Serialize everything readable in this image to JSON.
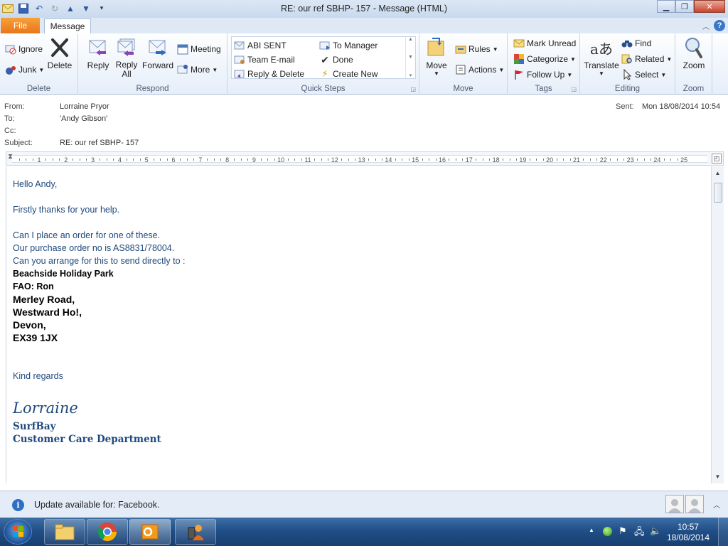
{
  "window": {
    "title": "RE: our ref SBHP- 157  -  Message (HTML)"
  },
  "tabs": {
    "file": "File",
    "message": "Message"
  },
  "ribbon": {
    "delete_group": {
      "label": "Delete",
      "ignore": "Ignore",
      "junk": "Junk",
      "delete": "Delete"
    },
    "respond_group": {
      "label": "Respond",
      "reply": "Reply",
      "reply_all_1": "Reply",
      "reply_all_2": "All",
      "forward": "Forward",
      "meeting": "Meeting",
      "more": "More"
    },
    "quicksteps_group": {
      "label": "Quick Steps",
      "items": [
        "ABI SENT",
        "Team E-mail",
        "Reply & Delete",
        "To Manager",
        "Done",
        "Create New"
      ]
    },
    "move_group": {
      "label": "Move",
      "move": "Move",
      "rules": "Rules",
      "actions": "Actions"
    },
    "tags_group": {
      "label": "Tags",
      "mark_unread": "Mark Unread",
      "categorize": "Categorize",
      "follow_up": "Follow Up"
    },
    "editing_group": {
      "label": "Editing",
      "translate": "Translate",
      "find": "Find",
      "related": "Related",
      "select": "Select"
    },
    "zoom_group": {
      "label": "Zoom",
      "zoom": "Zoom"
    }
  },
  "header": {
    "from_label": "From:",
    "from": "Lorraine Pryor",
    "to_label": "To:",
    "to": "'Andy Gibson'",
    "cc_label": "Cc:",
    "cc": "",
    "subject_label": "Subject:",
    "subject": "RE: our ref SBHP- 157",
    "sent_label": "Sent:",
    "sent": "Mon 18/08/2014 10:54"
  },
  "ruler": {
    "ticks": [
      "1",
      "2",
      "3",
      "4",
      "5",
      "6",
      "7",
      "8",
      "9",
      "10",
      "11",
      "12",
      "13",
      "14",
      "15",
      "16",
      "17",
      "18",
      "19",
      "20",
      "21",
      "22",
      "23",
      "24",
      "25"
    ]
  },
  "body": {
    "greeting": "Hello Andy,",
    "thanks": "Firstly thanks for your help.",
    "line1": "Can I place an order for one of these.",
    "line2": "Our purchase order no is AS8831/78004.",
    "line3": "Can you arrange for this to send directly to :",
    "address": [
      "Beachside Holiday Park",
      "FAO: Ron",
      "Merley Road,",
      "Westward Ho!,",
      "Devon,",
      "EX39 1JX"
    ],
    "regards": "Kind regards",
    "signature_name": "Lorraine",
    "company": "SurfBay",
    "department": "Customer Care Department"
  },
  "infobar": {
    "text": "Update available for: Facebook."
  },
  "taskbar": {
    "time": "10:57",
    "date": "18/08/2014"
  },
  "colors": {
    "body_text": "#1f497d",
    "file_tab": "#e9761a",
    "taskbar": "#1f4d85"
  }
}
